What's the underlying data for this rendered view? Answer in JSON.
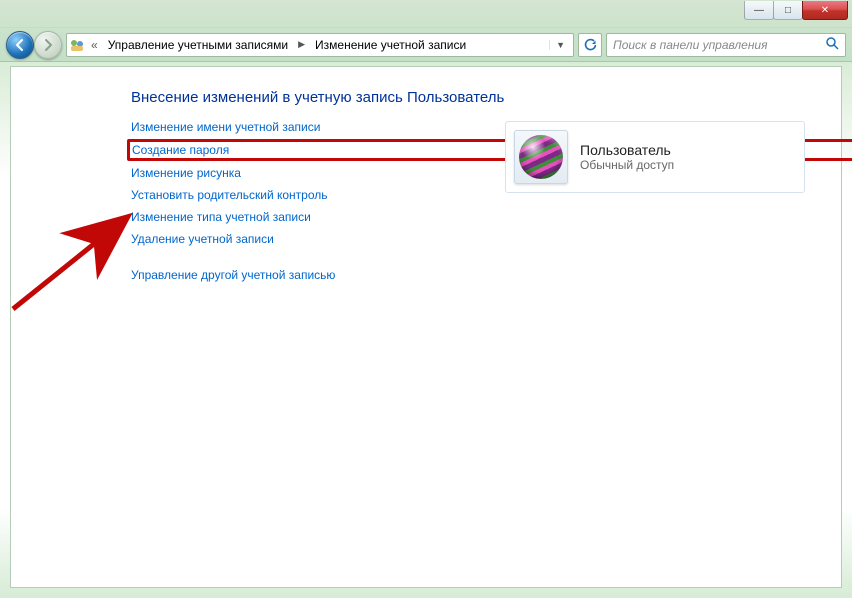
{
  "titlebar": {
    "minimize_glyph": "—",
    "maximize_glyph": "□",
    "close_glyph": "✕"
  },
  "breadcrumb": {
    "overflow_glyph": "«",
    "part1": "Управление учетными записями",
    "part2": "Изменение учетной записи"
  },
  "search": {
    "placeholder": "Поиск в панели управления"
  },
  "page": {
    "title": "Внесение изменений в учетную запись Пользователь"
  },
  "links": {
    "change_name": "Изменение имени учетной записи",
    "create_password": "Создание пароля",
    "change_picture": "Изменение рисунка",
    "parental": "Установить родительский контроль",
    "change_type": "Изменение типа учетной записи",
    "delete": "Удаление учетной записи",
    "manage_other": "Управление другой учетной записью"
  },
  "user": {
    "name": "Пользователь",
    "role": "Обычный доступ"
  }
}
